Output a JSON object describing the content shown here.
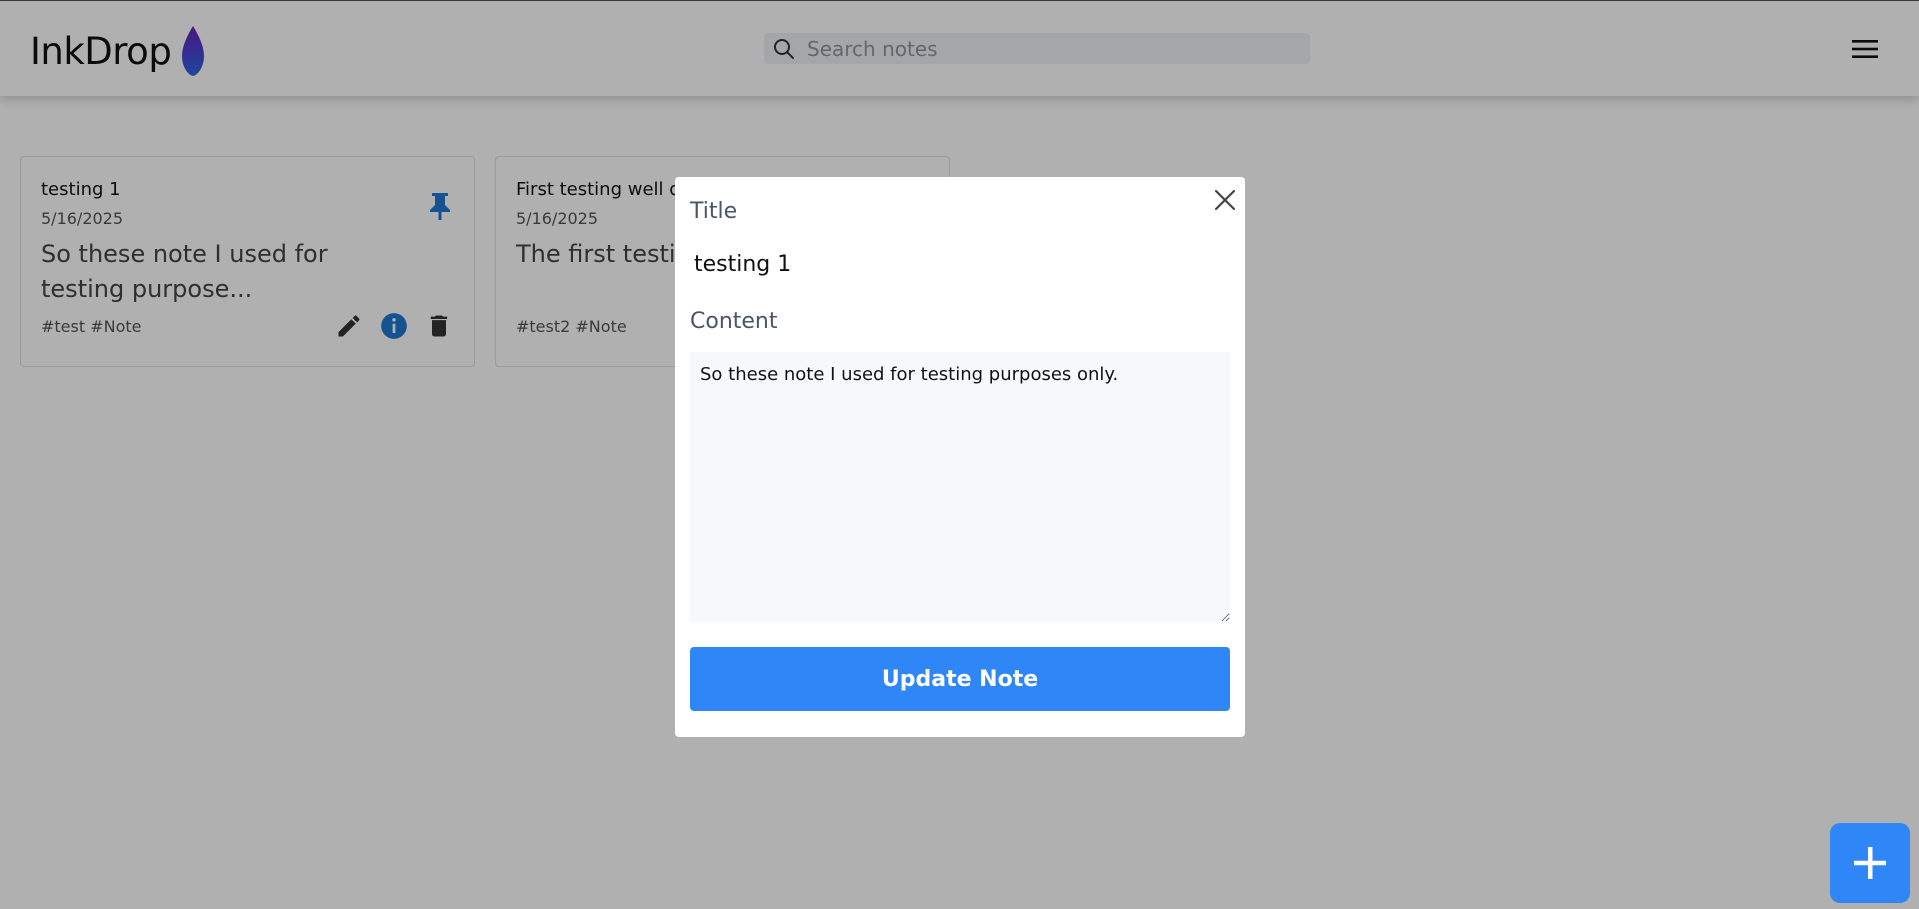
{
  "app": {
    "name": "InkDrop",
    "logo_icon": "ink-drop-icon",
    "colors": {
      "accent": "#2f86f6",
      "info": "#1e78d2",
      "overlay": "rgba(0,0,0,0.31)"
    }
  },
  "header": {
    "search": {
      "placeholder": "Search notes",
      "value": "",
      "icon": "search-icon"
    },
    "menu_icon": "hamburger-menu-icon"
  },
  "notes": [
    {
      "title": "testing 1",
      "date": "5/16/2025",
      "preview": "So these note I used for testing purpose...",
      "tags": "#test #Note",
      "pinned": true,
      "actions": [
        "edit-icon",
        "info-icon",
        "delete-icon"
      ]
    },
    {
      "title": "First testing well do",
      "date": "5/16/2025",
      "preview": "The first testing use...",
      "tags": "#test2 #Note"
    }
  ],
  "modal": {
    "title_label": "Title",
    "title_value": "testing 1",
    "content_label": "Content",
    "content_value": "So these note I used for testing purposes only.",
    "submit_label": "Update Note",
    "close_icon": "close-icon"
  },
  "fab": {
    "icon": "plus-icon"
  }
}
